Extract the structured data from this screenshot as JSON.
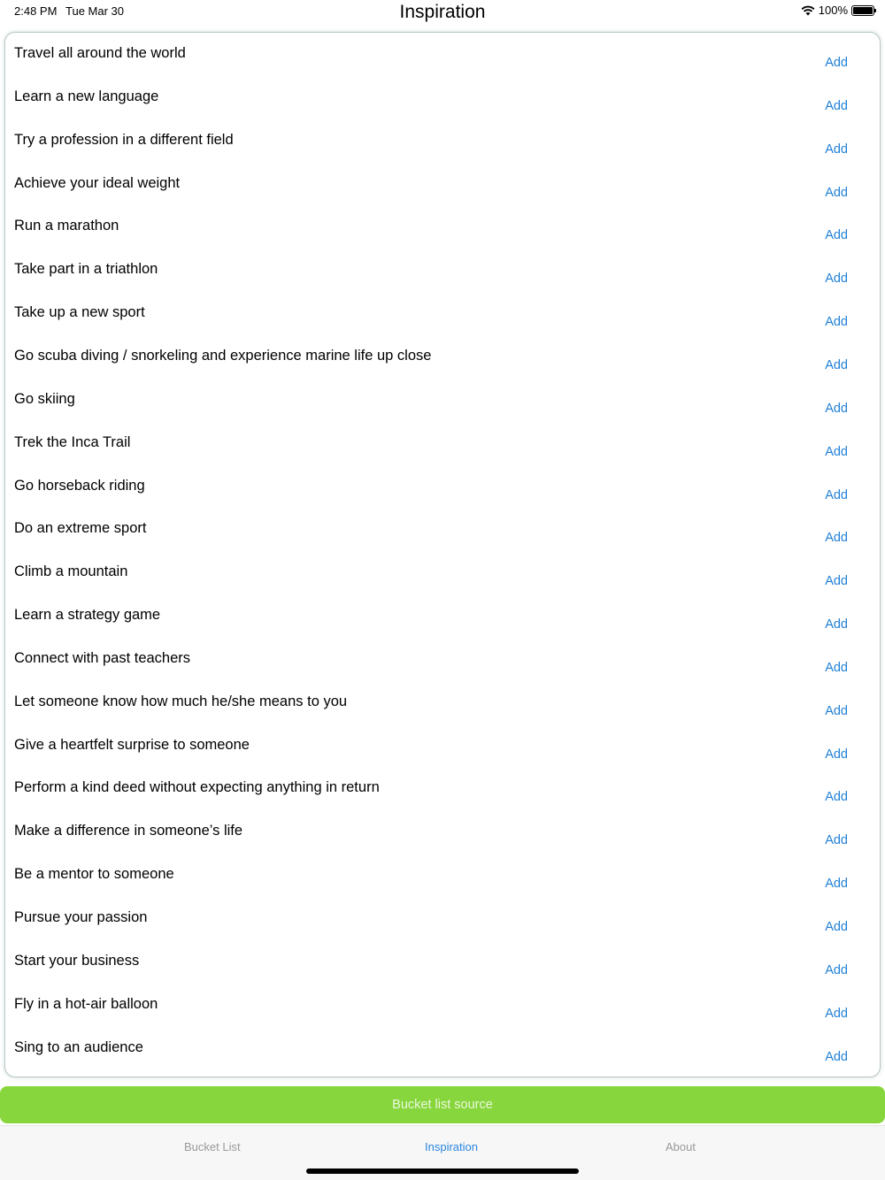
{
  "status": {
    "time": "2:48 PM",
    "date": "Tue Mar 30",
    "battery": "100%",
    "wifi_icon": "wifi-icon",
    "battery_icon": "battery-icon"
  },
  "title": "Inspiration",
  "items": [
    {
      "text": "Travel all around the world",
      "action": "Add"
    },
    {
      "text": "Learn a new language",
      "action": "Add"
    },
    {
      "text": "Try a profession in a different field",
      "action": "Add"
    },
    {
      "text": "Achieve your ideal weight",
      "action": "Add"
    },
    {
      "text": "Run a marathon",
      "action": "Add"
    },
    {
      "text": "Take part in a triathlon",
      "action": "Add"
    },
    {
      "text": "Take up a new sport",
      "action": "Add"
    },
    {
      "text": "Go scuba diving / snorkeling and experience marine life up close",
      "action": "Add"
    },
    {
      "text": "Go skiing",
      "action": "Add"
    },
    {
      "text": "Trek the Inca Trail",
      "action": "Add"
    },
    {
      "text": "Go horseback riding",
      "action": "Add"
    },
    {
      "text": "Do an extreme sport",
      "action": "Add"
    },
    {
      "text": "Climb a mountain",
      "action": "Add"
    },
    {
      "text": "Learn a strategy game",
      "action": "Add"
    },
    {
      "text": "Connect with past teachers",
      "action": "Add"
    },
    {
      "text": "Let someone know how much he/she means to you",
      "action": "Add"
    },
    {
      "text": "Give a heartfelt surprise to someone",
      "action": "Add"
    },
    {
      "text": "Perform a kind deed without expecting anything in return",
      "action": "Add"
    },
    {
      "text": "Make a difference in someone’s life",
      "action": "Add"
    },
    {
      "text": "Be a mentor to someone",
      "action": "Add"
    },
    {
      "text": "Pursue your passion",
      "action": "Add"
    },
    {
      "text": "Start your business",
      "action": "Add"
    },
    {
      "text": "Fly in a hot-air balloon",
      "action": "Add"
    },
    {
      "text": "Sing to an audience",
      "action": "Add"
    }
  ],
  "source_button": "Bucket list source",
  "tabs": [
    {
      "label": "Bucket List",
      "active": false
    },
    {
      "label": "Inspiration",
      "active": true
    },
    {
      "label": "About",
      "active": false
    }
  ],
  "colors": {
    "accent": "#2a86de",
    "add_link": "#1f7fd6",
    "source_button": "#88d63d",
    "inactive_tab": "#9a9a9a"
  }
}
